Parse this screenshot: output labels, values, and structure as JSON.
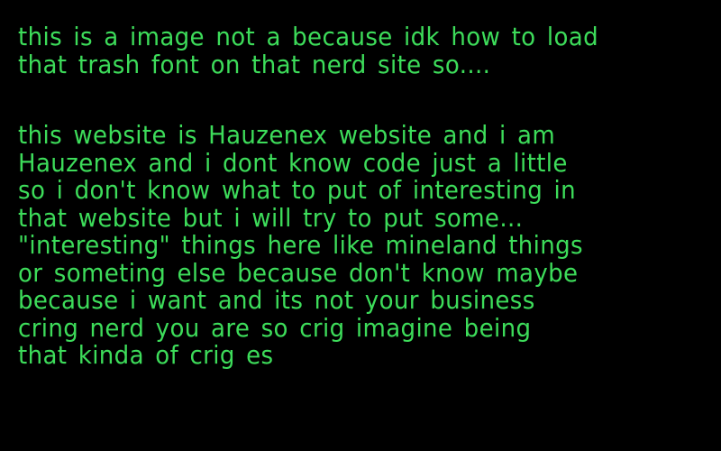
{
  "colors": {
    "background": "#000000",
    "text": "#3ddc5a"
  },
  "intro": [
    "this is a image not a because idk how to load",
    "that trash font on that nerd site so...."
  ],
  "body": [
    "this website is Hauzenex website and i am",
    "Hauzenex and i dont know code just a little",
    "so i don't know what to put of interesting in",
    "that website but i will try to put some...",
    "\"interesting\" things here like mineland things",
    "or someting else because  don't know maybe",
    "because i want and its not your business",
    "cring nerd you are so crig imagine being",
    "that kinda of crig es"
  ]
}
